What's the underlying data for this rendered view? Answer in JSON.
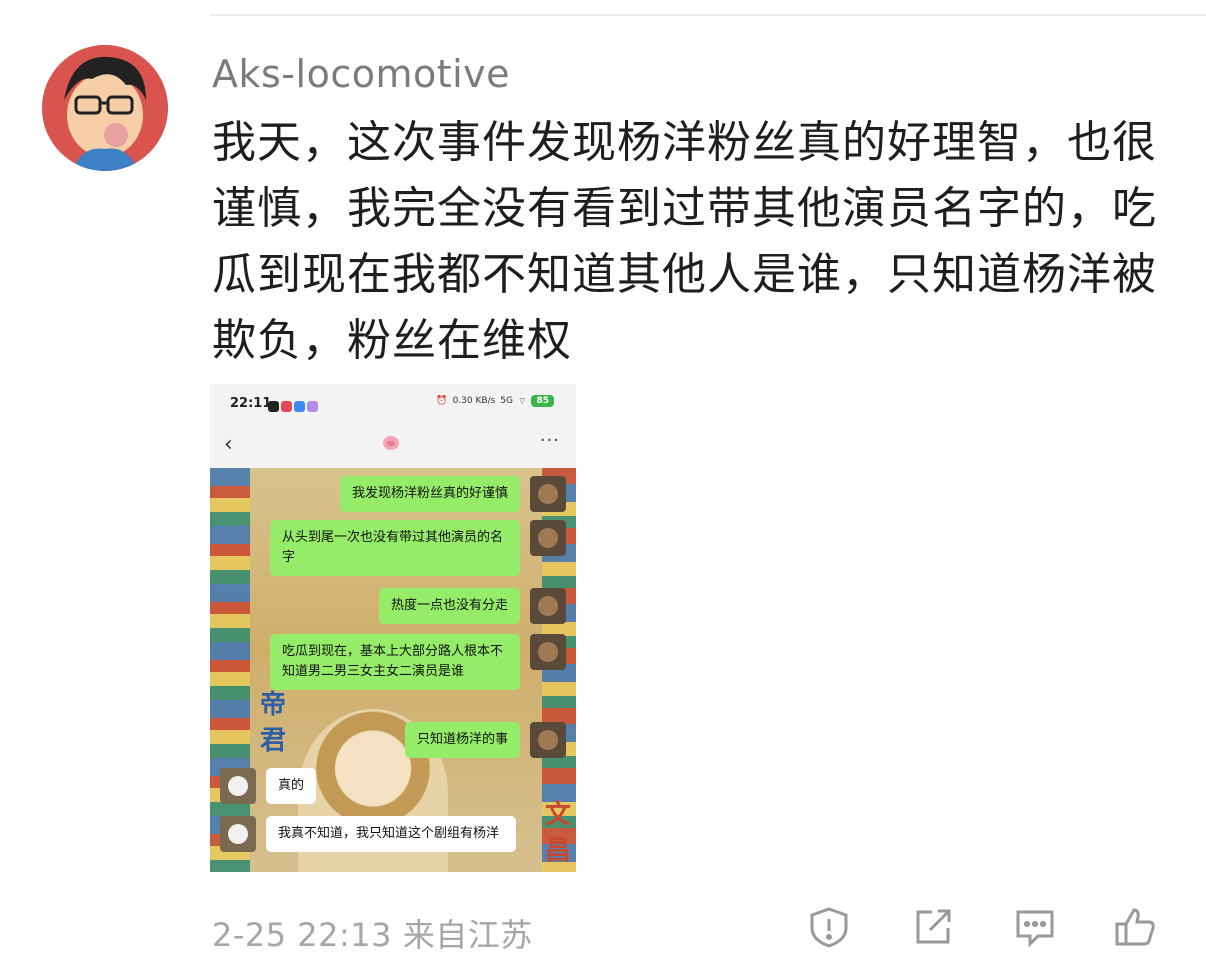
{
  "comment": {
    "username": "Aks-locomotive",
    "text": "我天，这次事件发现杨洋粉丝真的好理智，也很谨慎，我完全没有看到过带其他演员名字的，吃瓜到现在我都不知道其他人是谁，只知道杨洋被欺负，粉丝在维权",
    "time_location": "2-25 22:13 来自江苏"
  },
  "screenshot": {
    "status_time": "22:11",
    "network_speed": "0.30 KB/s",
    "signal": "5G",
    "battery": "85",
    "back_glyph": "‹",
    "more_glyph": "···",
    "messages": [
      {
        "text": "我发现杨洋粉丝真的好谨慎",
        "side": "right"
      },
      {
        "text": "从头到尾一次也没有带过其他演员的名字",
        "side": "right"
      },
      {
        "text": "热度一点也没有分走",
        "side": "right"
      },
      {
        "text": "吃瓜到现在，基本上大部分路人根本不知道男二男三女主女二演员是谁",
        "side": "right"
      },
      {
        "text": "只知道杨洋的事",
        "side": "right"
      },
      {
        "text": "真的",
        "side": "left"
      },
      {
        "text": "我真不知道，我只知道这个剧组有杨洋",
        "side": "left"
      }
    ],
    "background_chars": [
      "帝",
      "君",
      "文",
      "昌"
    ]
  },
  "actions": [
    {
      "name": "report-icon"
    },
    {
      "name": "share-icon"
    },
    {
      "name": "comment-icon"
    },
    {
      "name": "like-icon"
    }
  ],
  "colors": {
    "bubble_green": "#95ec69",
    "text_dark": "#1e1e1e",
    "meta_gray": "#a6a6a6"
  }
}
